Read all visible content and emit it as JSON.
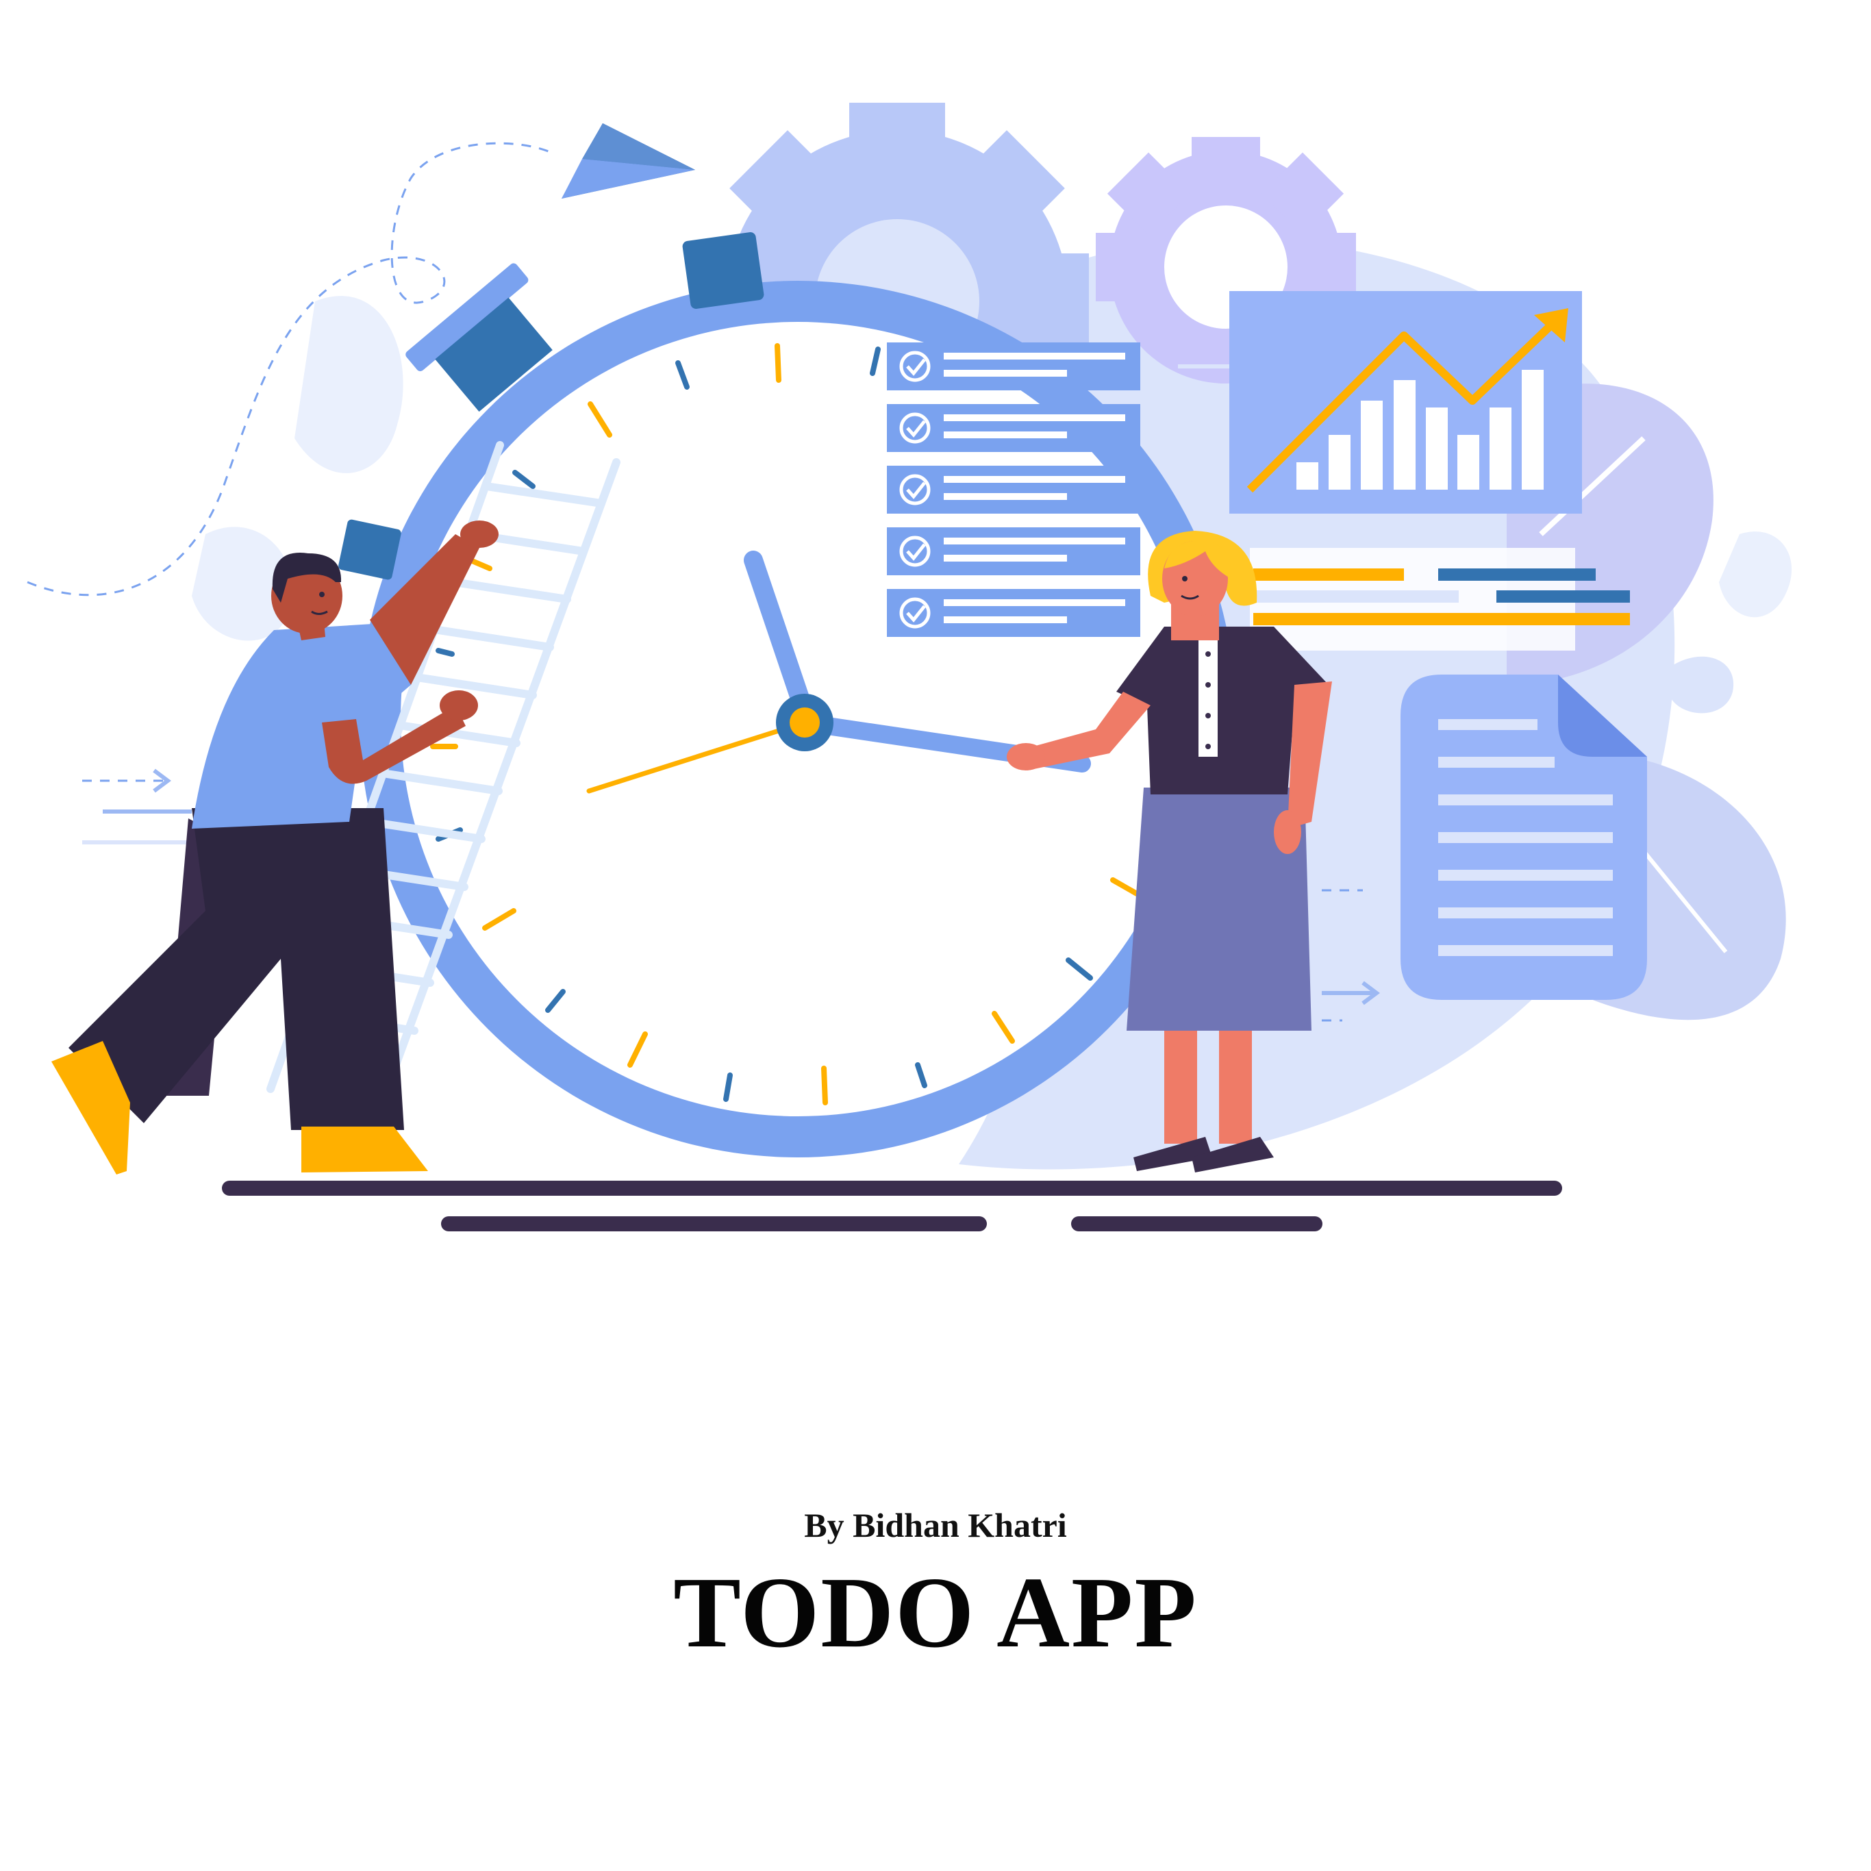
{
  "splash": {
    "author_line": "By Bidhan Khatri",
    "app_title": "TODO APP"
  },
  "illustration": {
    "icons": [
      "clock-icon",
      "gear-icon",
      "paper-plane-icon",
      "checklist-icon",
      "growth-chart-icon",
      "document-icon",
      "ladder-icon"
    ],
    "checklist_item_count": 5
  },
  "colors": {
    "primary_blue": "#7aa2ef",
    "dark_blue": "#3373b0",
    "light_blue": "#dbe4fb",
    "accent_yellow": "#ffb000",
    "dark_navy": "#3a2d4d",
    "skin_dark": "#b84e3a",
    "skin_light": "#ef7b67",
    "gear_lavender": "#c9c6fb",
    "gear_blue": "#b8c8f8"
  }
}
